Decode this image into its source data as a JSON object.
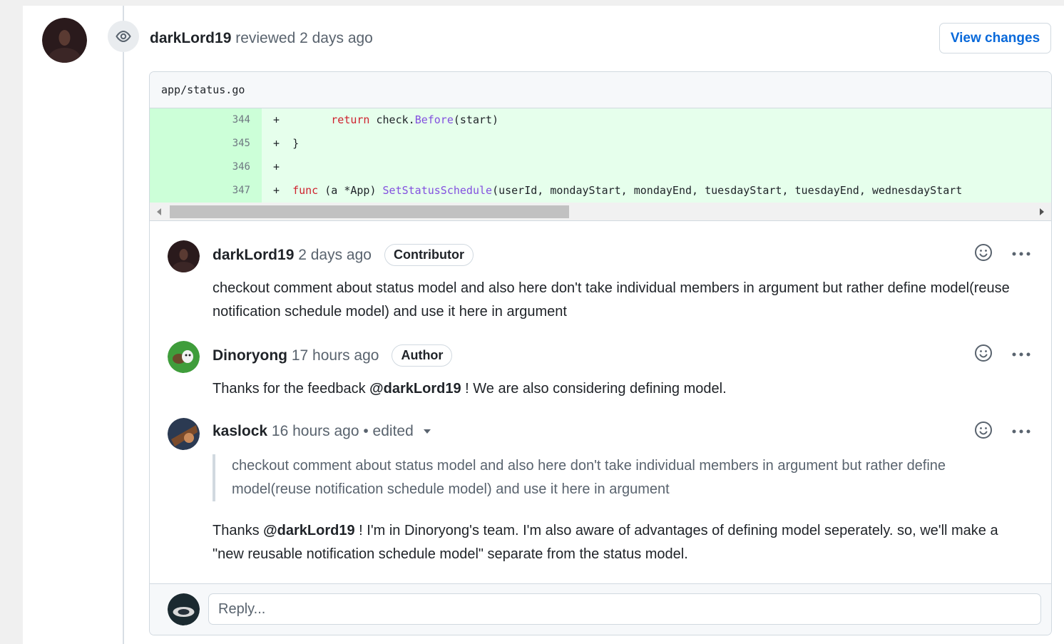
{
  "review": {
    "author": "darkLord19",
    "action": "reviewed",
    "time": "2 days ago",
    "view_changes_label": "View changes"
  },
  "file": {
    "path": "app/status.go",
    "lines": [
      {
        "number": "344",
        "prefix": "+",
        "indent": "       ",
        "parts": [
          {
            "t": "return",
            "c": "kw"
          },
          {
            "t": " check.",
            "c": ""
          },
          {
            "t": "Before",
            "c": "fn"
          },
          {
            "t": "(start)",
            "c": ""
          }
        ]
      },
      {
        "number": "345",
        "prefix": "+",
        "indent": " ",
        "parts": [
          {
            "t": "}",
            "c": ""
          }
        ]
      },
      {
        "number": "346",
        "prefix": "+",
        "indent": "",
        "parts": []
      },
      {
        "number": "347",
        "prefix": "+",
        "indent": " ",
        "parts": [
          {
            "t": "func",
            "c": "kw"
          },
          {
            "t": " (a *App) ",
            "c": ""
          },
          {
            "t": "SetStatusSchedule",
            "c": "fn"
          },
          {
            "t": "(userId, mondayStart, mondayEnd, tuesdayStart, tuesdayEnd, wednesdayStart",
            "c": ""
          }
        ]
      }
    ]
  },
  "comments": [
    {
      "author": "darkLord19",
      "time": "2 days ago",
      "badge": "Contributor",
      "body": "checkout comment about status model and also here don't take individual members in argument but rather define model(reuse notification schedule model) and use it here in argument"
    },
    {
      "author": "Dinoryong",
      "time": "17 hours ago",
      "badge": "Author",
      "body_before": "Thanks for the feedback ",
      "mention": "@darkLord19",
      "body_after": " ! We are also considering defining model."
    },
    {
      "author": "kaslock",
      "time": "16 hours ago",
      "edited": "• edited",
      "quote": "checkout comment about status model and also here don't take individual members in argument but rather define model(reuse notification schedule model) and use it here in argument",
      "body_before": "Thanks ",
      "mention": "@darkLord19",
      "body_after": " ! I'm in Dinoryong's team. I'm also aware of advantages of defining model seperately. so, we'll make a \"new reusable notification schedule model\" separate from the status model."
    }
  ],
  "reply": {
    "placeholder": "Reply..."
  },
  "icons": {
    "review": "eye-icon",
    "reaction": "smiley-icon",
    "more": "kebab-horizontal-icon",
    "edited_menu": "triangle-down-icon"
  },
  "colors": {
    "link": "#0969da",
    "addition_bg": "#e6ffec",
    "addition_gutter": "#ccffd8",
    "keyword": "#cf222e",
    "function": "#8250df"
  }
}
